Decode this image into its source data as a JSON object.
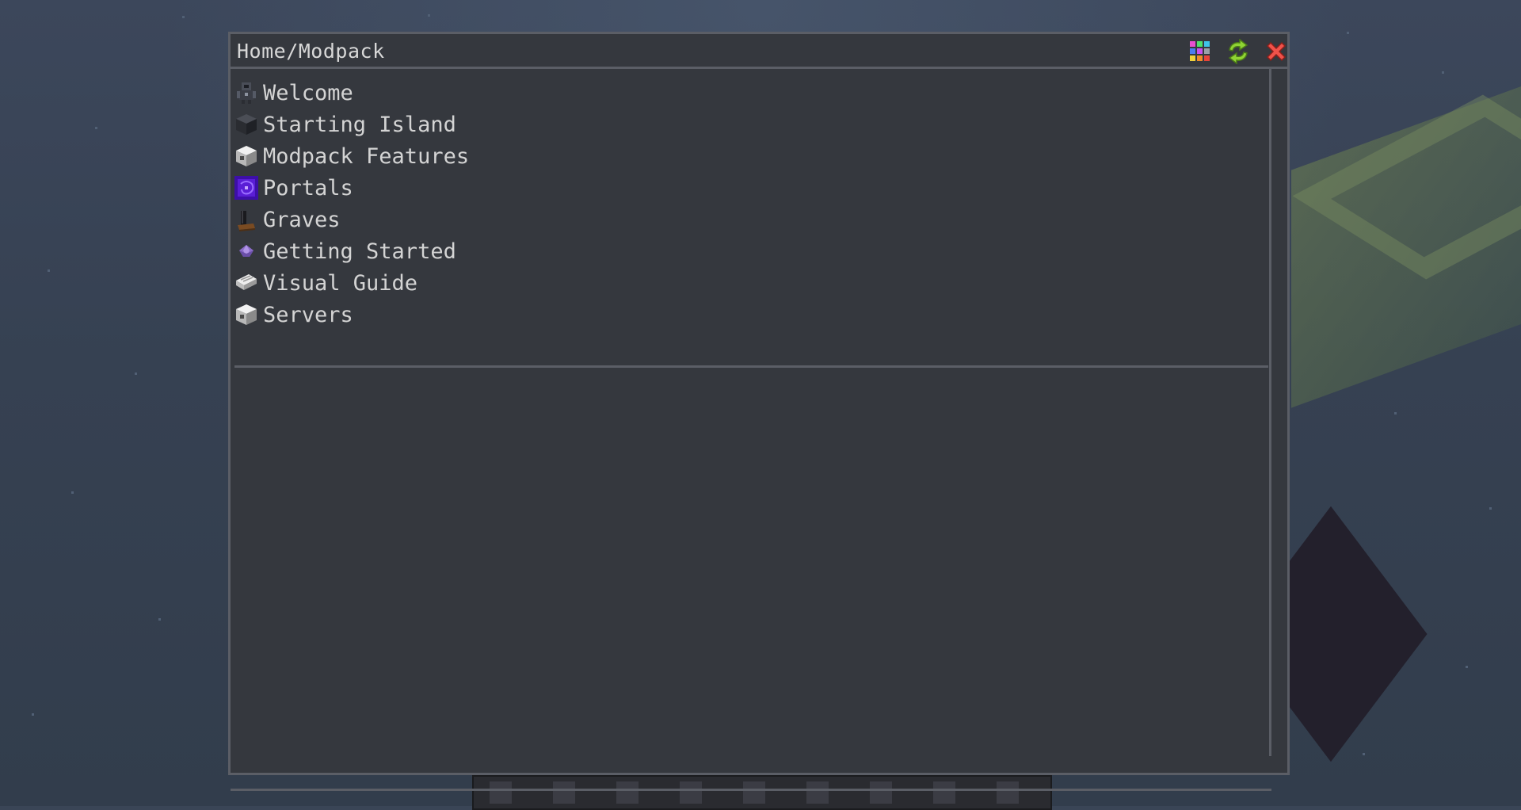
{
  "window": {
    "breadcrumb": "Home/Modpack",
    "buttons": [
      {
        "name": "item-grid-button",
        "icon": "colorful-grid-icon"
      },
      {
        "name": "refresh-button",
        "icon": "refresh-icon"
      },
      {
        "name": "close-button",
        "icon": "close-icon"
      }
    ]
  },
  "entries": [
    {
      "label": "Welcome",
      "icon": "dark-robot-icon"
    },
    {
      "label": "Starting Island",
      "icon": "dark-block-icon"
    },
    {
      "label": "Modpack Features",
      "icon": "white-block-icon"
    },
    {
      "label": "Portals",
      "icon": "purple-portal-icon"
    },
    {
      "label": "Graves",
      "icon": "gravestone-icon"
    },
    {
      "label": "Getting Started",
      "icon": "purple-gem-icon"
    },
    {
      "label": "Visual Guide",
      "icon": "book-icon"
    },
    {
      "label": "Servers",
      "icon": "white-block-icon"
    }
  ],
  "colors": {
    "panel_bg": "#35383e",
    "panel_border": "#5b5e66",
    "text": "#d4d4d4",
    "close_red": "#e8433a",
    "refresh_green": "#7cc530"
  }
}
